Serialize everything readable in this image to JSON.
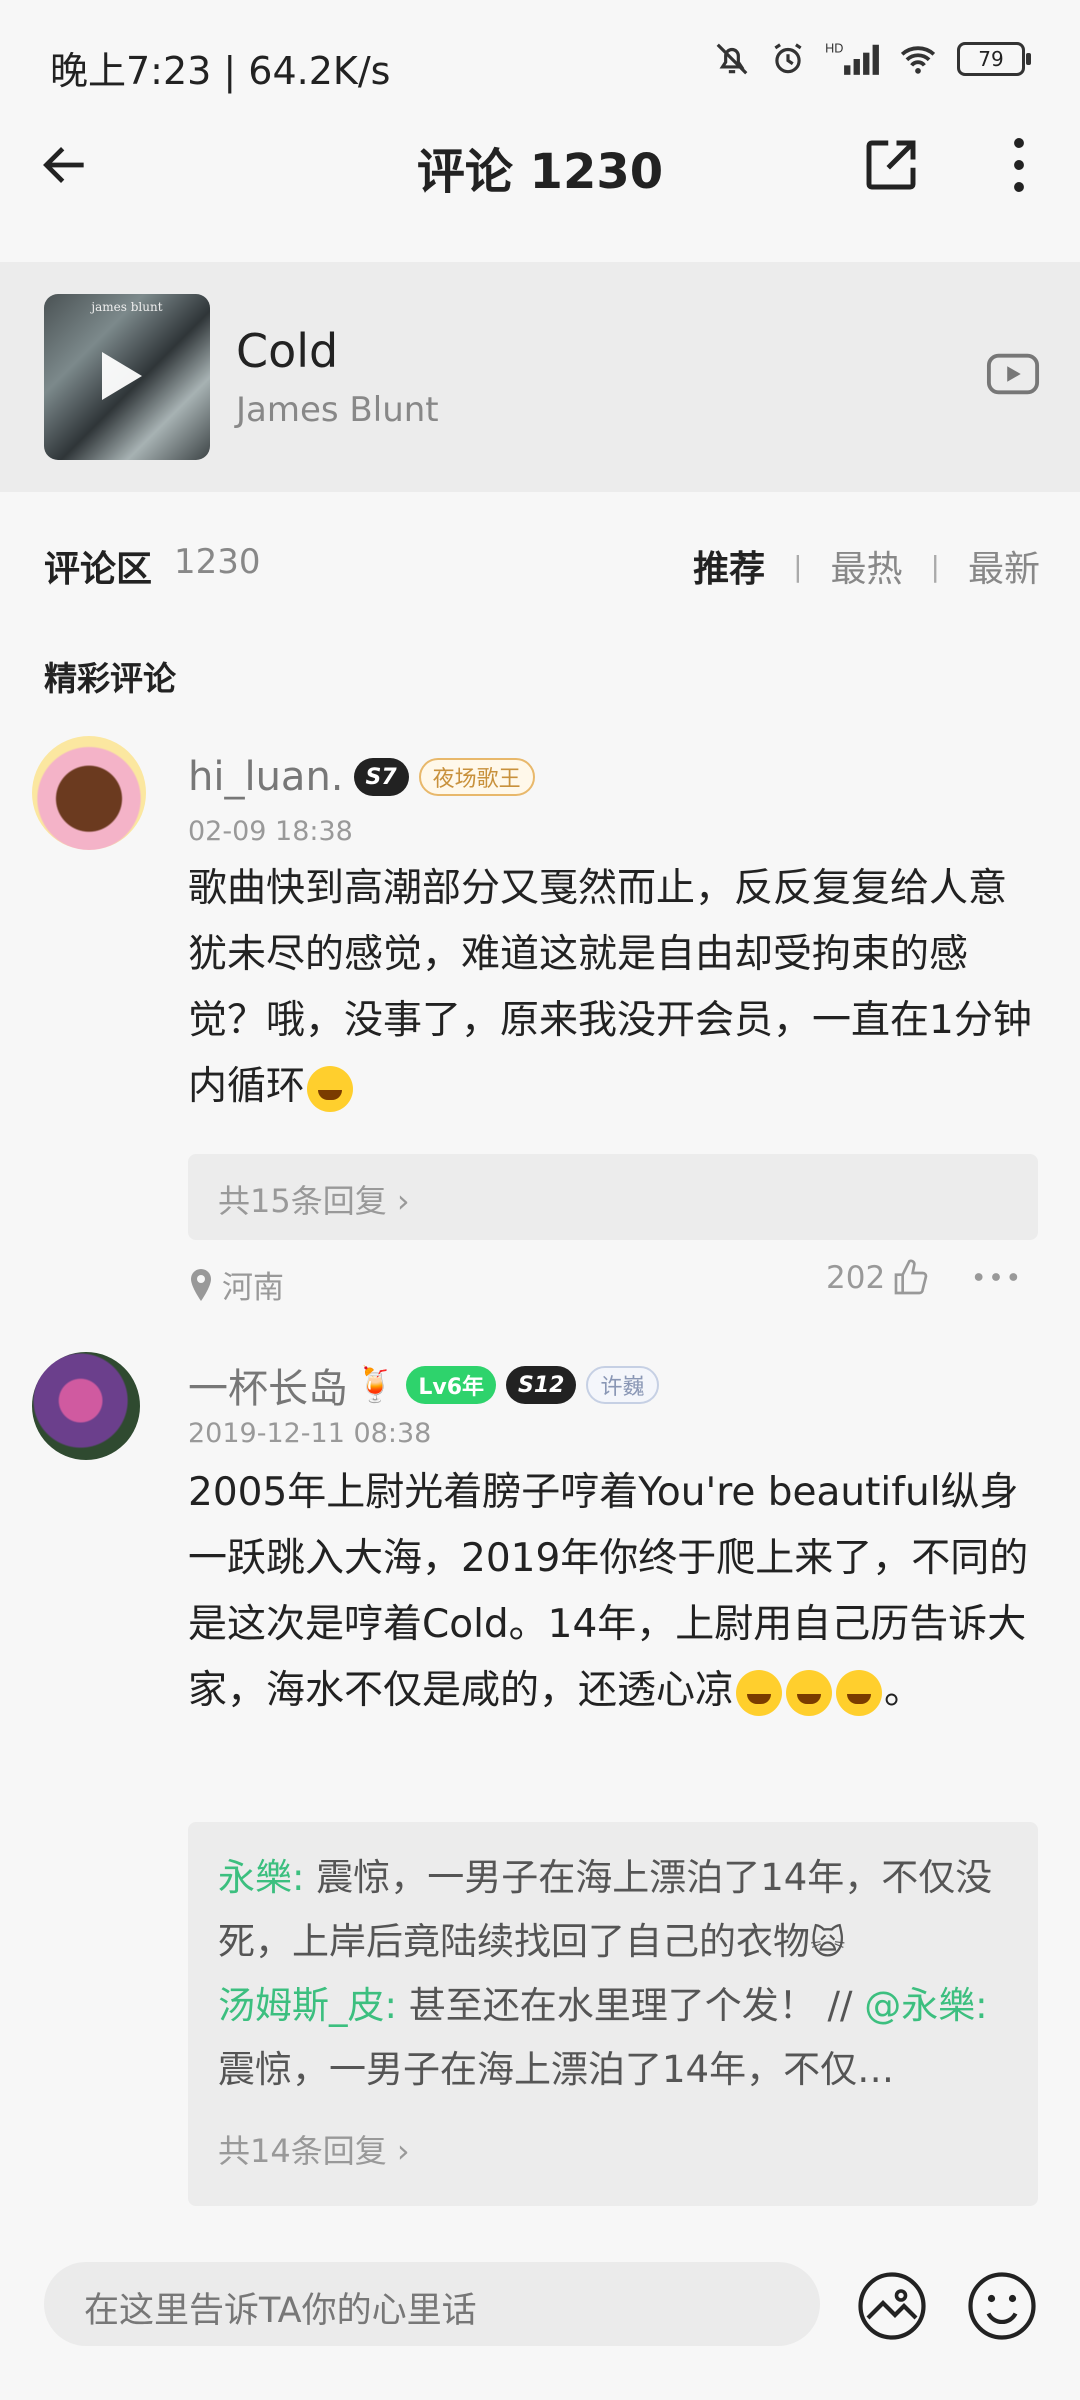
{
  "status_bar": {
    "time": "晚上7:23 | 64.2K/s",
    "network": "HD",
    "battery": "79"
  },
  "header": {
    "title": "评论 1230",
    "back_icon": "arrow-left-icon",
    "share_icon": "share-icon",
    "more_icon": "more-vertical-icon"
  },
  "song": {
    "title": "Cold",
    "artist": "James Blunt",
    "cover_text": "james blunt",
    "cover_icon": "play-icon",
    "mv_icon": "video-icon"
  },
  "comments_area": {
    "label": "评论区",
    "count": "1230",
    "sort": [
      "推荐",
      "最热",
      "最新"
    ],
    "sort_active": "推荐",
    "featured_label": "精彩评论"
  },
  "comments": [
    {
      "username": "hi_luan.",
      "badges": [
        "S7",
        "夜场歌王"
      ],
      "time": "02-09 18:38",
      "text": "歌曲快到高潮部分又戛然而止，反反复复给人意犹未尽的感觉，难道这就是自由却受拘束的感觉？哦，没事了，原来我没开会员，一直在1分钟内循环",
      "replies_label": "共15条回复 ›",
      "location": "河南",
      "likes": "202"
    },
    {
      "username": "一杯长岛",
      "badges": [
        "Lv6年",
        "S12",
        "许巍"
      ],
      "time": "2019-12-11 08:38",
      "text": "2005年上尉光着膀子哼着You're beautiful纵身一跃跳入大海，2019年你终于爬上来了，不同的是这次是哼着Cold。14年，上尉用自己历告诉大家，海水不仅是咸的，还透心凉",
      "text_end": "。",
      "replies": [
        {
          "user": "永樂:",
          "text": " 震惊，一男子在海上漂泊了14年，不仅没死，上岸后竟陆续找回了自己的衣物"
        },
        {
          "user": "汤姆斯_皮:",
          "text": " 甚至还在水里理了个发！ // ",
          "mention": "@永樂:",
          "quoted": " 震惊，一男子在海上漂泊了14年，不仅…"
        }
      ],
      "replies_label": "共14条回复 ›"
    }
  ],
  "input": {
    "placeholder": "在这里告诉TA你的心里话",
    "image_icon": "image-icon",
    "emoji_icon": "emoji-icon"
  }
}
